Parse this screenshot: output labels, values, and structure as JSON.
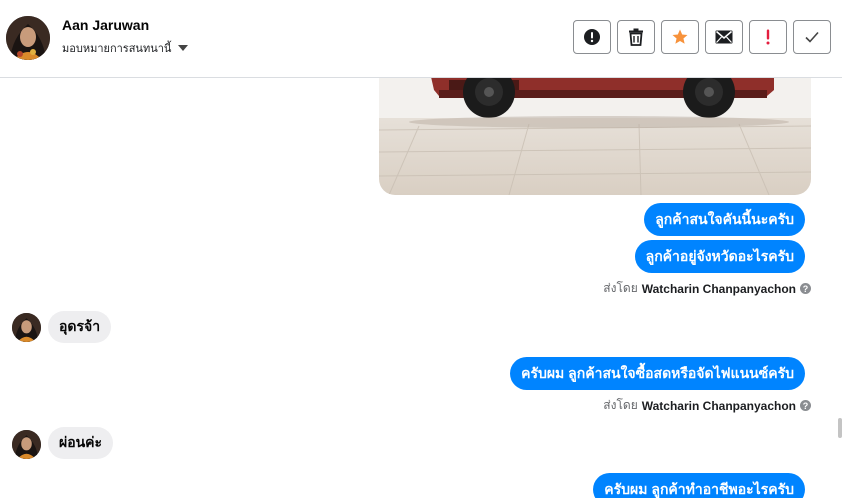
{
  "header": {
    "contact_name": "Aan Jaruwan",
    "assign_label": "มอบหมายการสนทนานี้",
    "actions": [
      {
        "name": "spam-button",
        "icon": "alert-circle-icon"
      },
      {
        "name": "delete-button",
        "icon": "trash-icon"
      },
      {
        "name": "star-button",
        "icon": "star-icon"
      },
      {
        "name": "mark-unread-button",
        "icon": "envelope-icon"
      },
      {
        "name": "follow-up-button",
        "icon": "exclamation-icon"
      },
      {
        "name": "mark-done-button",
        "icon": "checkmark-icon"
      }
    ],
    "colors": {
      "star": "#f7923b",
      "followup": "#e41e3f",
      "border": "#8a8d91"
    }
  },
  "messages": {
    "out1": "ลูกค้าสนใจคันนี้นะครับ",
    "out2": "ลูกค้าอยู่จังหวัดอะไรครับ",
    "sent1_prefix": "ส่งโดย",
    "sent1_name": "Watcharin Chanpanyachon",
    "in1": "อุดรจ้า",
    "out3": "ครับผม ลูกค้าสนใจซื้อสดหรือจัดไฟแนนซ์ครับ",
    "sent2_prefix": "ส่งโดย",
    "sent2_name": "Watcharin Chanpanyachon",
    "in2": "ผ่อนค่ะ",
    "out4": "ครับผม ลูกค้าทำอาชีพอะไรครับ"
  },
  "colors": {
    "outgoing_bubble": "#0084ff",
    "incoming_bubble": "#eeeef0"
  }
}
